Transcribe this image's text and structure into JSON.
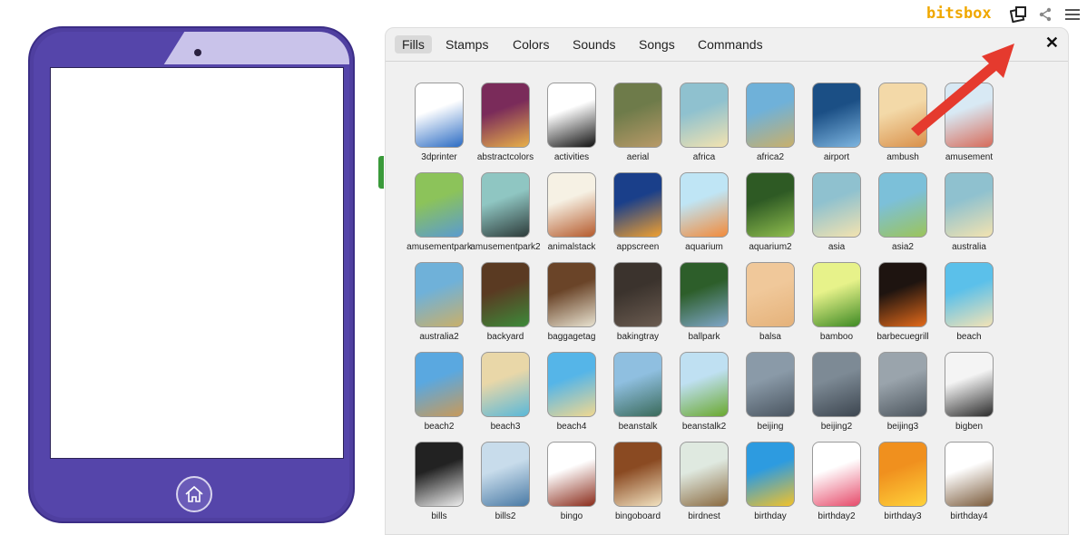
{
  "brand": {
    "logo_text": "bitsbox",
    "logo_color": "#f0a800"
  },
  "topbar": {
    "icons": [
      "tablet-icon",
      "share-icon",
      "menu-icon"
    ]
  },
  "tabs": [
    {
      "label": "Fills",
      "active": true
    },
    {
      "label": "Stamps",
      "active": false
    },
    {
      "label": "Colors",
      "active": false
    },
    {
      "label": "Sounds",
      "active": false
    },
    {
      "label": "Songs",
      "active": false
    },
    {
      "label": "Commands",
      "active": false
    }
  ],
  "close_label": "✕",
  "fills": [
    {
      "name": "3dprinter",
      "c1": "#ffffff",
      "c2": "#2b6cc4"
    },
    {
      "name": "abstractcolors",
      "c1": "#7a2b5a",
      "c2": "#e8b04a"
    },
    {
      "name": "activities",
      "c1": "#ffffff",
      "c2": "#111111"
    },
    {
      "name": "aerial",
      "c1": "#6e7b4a",
      "c2": "#b89a68"
    },
    {
      "name": "africa",
      "c1": "#8fc1cf",
      "c2": "#f3e3b0"
    },
    {
      "name": "africa2",
      "c1": "#6fb1d9",
      "c2": "#c9b06a"
    },
    {
      "name": "airport",
      "c1": "#1b4f85",
      "c2": "#7db5e0"
    },
    {
      "name": "ambush",
      "c1": "#f3d9a8",
      "c2": "#d9904a"
    },
    {
      "name": "amusement",
      "c1": "#d8e9f4",
      "c2": "#d76b5a"
    },
    {
      "name": "amusementpark",
      "c1": "#8cc35a",
      "c2": "#5a9bd0"
    },
    {
      "name": "amusementpark2",
      "c1": "#8fc6c2",
      "c2": "#2d3b3a"
    },
    {
      "name": "animalstack",
      "c1": "#f6f1e4",
      "c2": "#b55a2c"
    },
    {
      "name": "appscreen",
      "c1": "#1a3f8a",
      "c2": "#f0a030"
    },
    {
      "name": "aquarium",
      "c1": "#bfe5f5",
      "c2": "#f28a3a"
    },
    {
      "name": "aquarium2",
      "c1": "#2e5a24",
      "c2": "#8fbd4e"
    },
    {
      "name": "asia",
      "c1": "#8fc1cf",
      "c2": "#f3e3b0"
    },
    {
      "name": "asia2",
      "c1": "#7cc0d9",
      "c2": "#9cc45a"
    },
    {
      "name": "australia",
      "c1": "#8fc1cf",
      "c2": "#f3e3b0"
    },
    {
      "name": "australia2",
      "c1": "#6fb1d9",
      "c2": "#c9b06a"
    },
    {
      "name": "backyard",
      "c1": "#5a3a22",
      "c2": "#3d8a3a"
    },
    {
      "name": "baggagetag",
      "c1": "#6a4428",
      "c2": "#e8e2d0"
    },
    {
      "name": "bakingtray",
      "c1": "#3b332d",
      "c2": "#6a5b50"
    },
    {
      "name": "ballpark",
      "c1": "#2d5e2a",
      "c2": "#7fa6c8"
    },
    {
      "name": "balsa",
      "c1": "#f0c89a",
      "c2": "#e5b27a"
    },
    {
      "name": "bamboo",
      "c1": "#e7f28a",
      "c2": "#3e8a24"
    },
    {
      "name": "barbecuegrill",
      "c1": "#1e1410",
      "c2": "#e36a1a"
    },
    {
      "name": "beach",
      "c1": "#5bc0ea",
      "c2": "#f4e3b5"
    },
    {
      "name": "beach2",
      "c1": "#5aa8e0",
      "c2": "#c89a5a"
    },
    {
      "name": "beach3",
      "c1": "#e9d7a8",
      "c2": "#5ab8d8"
    },
    {
      "name": "beach4",
      "c1": "#55b5e8",
      "c2": "#f1d890"
    },
    {
      "name": "beanstalk",
      "c1": "#8fbfe0",
      "c2": "#3a6a5a"
    },
    {
      "name": "beanstalk2",
      "c1": "#bfe0f2",
      "c2": "#6aa82e"
    },
    {
      "name": "beijing",
      "c1": "#8a9aa8",
      "c2": "#4a5560"
    },
    {
      "name": "beijing2",
      "c1": "#7d8a95",
      "c2": "#3d4650"
    },
    {
      "name": "beijing3",
      "c1": "#9aa4ac",
      "c2": "#4c555d"
    },
    {
      "name": "bigben",
      "c1": "#f4f4f4",
      "c2": "#2b2b2b"
    },
    {
      "name": "bills",
      "c1": "#222222",
      "c2": "#eeeeee"
    },
    {
      "name": "bills2",
      "c1": "#c8dceb",
      "c2": "#4a7aa5"
    },
    {
      "name": "bingo",
      "c1": "#ffffff",
      "c2": "#8a2b1a"
    },
    {
      "name": "bingoboard",
      "c1": "#8a4a22",
      "c2": "#f2e2c0"
    },
    {
      "name": "birdnest",
      "c1": "#dfe9e0",
      "c2": "#8a6a40"
    },
    {
      "name": "birthday",
      "c1": "#2d9be0",
      "c2": "#f2c22a"
    },
    {
      "name": "birthday2",
      "c1": "#ffffff",
      "c2": "#e64a6a"
    },
    {
      "name": "birthday3",
      "c1": "#f0901e",
      "c2": "#ffd23a"
    },
    {
      "name": "birthday4",
      "c1": "#ffffff",
      "c2": "#7a5a3a"
    }
  ]
}
